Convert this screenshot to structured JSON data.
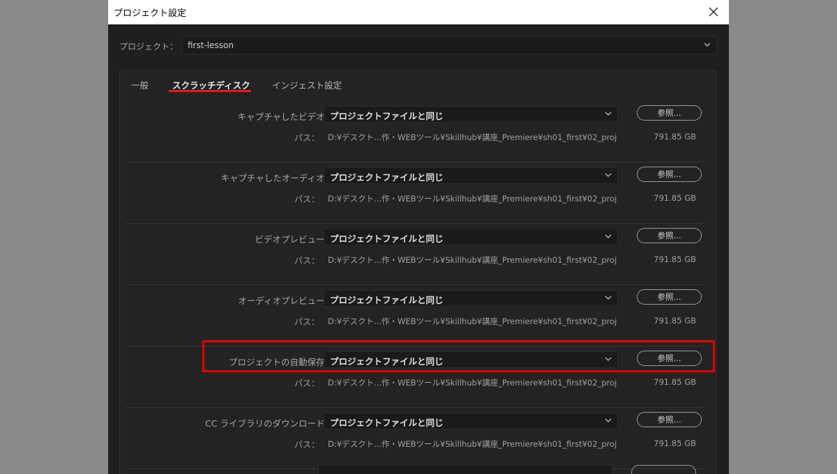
{
  "dialog": {
    "title": "プロジェクト設定",
    "close_icon": "close-icon"
  },
  "project": {
    "label": "プロジェクト：",
    "value": "first-lesson"
  },
  "tabs": [
    {
      "label": "一般",
      "active": false
    },
    {
      "label": "スクラッチディスク",
      "active": true
    },
    {
      "label": "インジェスト設定",
      "active": false
    }
  ],
  "rows": [
    {
      "label": "キャプチャしたビデオ：",
      "value": "プロジェクトファイルと同じ",
      "browse": "参照...",
      "path_label": "パス：",
      "path": "D:¥デスクト...作・WEBツール¥Skillhub¥講座_Premiere¥sh01_first¥02_proj",
      "size": "791.85 GB"
    },
    {
      "label": "キャプチャしたオーディオ：",
      "value": "プロジェクトファイルと同じ",
      "browse": "参照...",
      "path_label": "パス：",
      "path": "D:¥デスクト...作・WEBツール¥Skillhub¥講座_Premiere¥sh01_first¥02_proj",
      "size": "791.85 GB"
    },
    {
      "label": "ビデオプレビュー：",
      "value": "プロジェクトファイルと同じ",
      "browse": "参照...",
      "path_label": "パス：",
      "path": "D:¥デスクト...作・WEBツール¥Skillhub¥講座_Premiere¥sh01_first¥02_proj",
      "size": "791.85 GB"
    },
    {
      "label": "オーディオプレビュー：",
      "value": "プロジェクトファイルと同じ",
      "browse": "参照...",
      "path_label": "パス：",
      "path": "D:¥デスクト...作・WEBツール¥Skillhub¥講座_Premiere¥sh01_first¥02_proj",
      "size": "791.85 GB"
    },
    {
      "label": "プロジェクトの自動保存：",
      "value": "プロジェクトファイルと同じ",
      "browse": "参照...",
      "path_label": "パス：",
      "path": "D:¥デスクト...作・WEBツール¥Skillhub¥講座_Premiere¥sh01_first¥02_proj",
      "size": "791.85 GB"
    },
    {
      "label": "CC ライブラリのダウンロード：",
      "value": "プロジェクトファイルと同じ",
      "browse": "参照...",
      "path_label": "パス：",
      "path": "D:¥デスクト...作・WEBツール¥Skillhub¥講座_Premiere¥sh01_first¥02_proj",
      "size": "791.85 GB"
    }
  ],
  "colors": {
    "accent_underline": "#e8191a",
    "highlight_box": "#e00000",
    "dialog_bg": "#1f1f1f"
  }
}
